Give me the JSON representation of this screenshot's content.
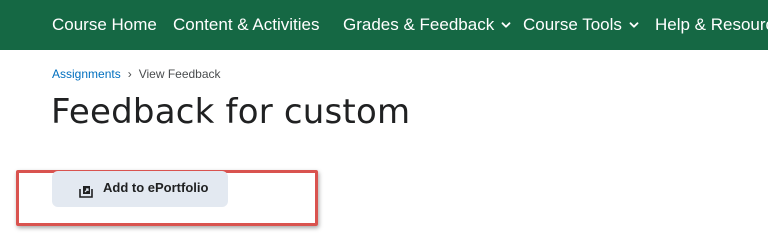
{
  "nav": {
    "items": [
      {
        "label": "Course Home",
        "has_dropdown": false
      },
      {
        "label": "Content & Activities",
        "has_dropdown": false
      },
      {
        "label": "Grades & Feedback",
        "has_dropdown": true
      },
      {
        "label": "Course Tools",
        "has_dropdown": true
      },
      {
        "label": "Help & Resources",
        "has_dropdown": false
      }
    ],
    "background_color": "#156844"
  },
  "breadcrumb": {
    "link_label": "Assignments",
    "separator": "›",
    "current": "View Feedback"
  },
  "page": {
    "title": "Feedback for custom"
  },
  "actions": {
    "add_to_eportfolio_label": "Add to ePortfolio",
    "add_to_eportfolio_icon": "eportfolio-add-icon"
  },
  "annotation": {
    "highlight_color": "#d9534f"
  }
}
